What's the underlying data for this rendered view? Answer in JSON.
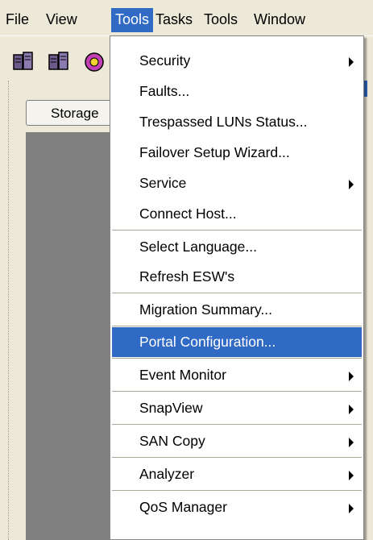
{
  "menubar": {
    "items": [
      {
        "label": "File"
      },
      {
        "label": "View"
      },
      {
        "label": "Tools"
      },
      {
        "label": "Tasks"
      },
      {
        "label": "Tools"
      },
      {
        "label": "Window"
      }
    ]
  },
  "toolbar": {
    "icons": [
      "storage-system-icon",
      "storage-system-icon",
      "wizard-icon"
    ]
  },
  "panel": {
    "tab_label": "Storage"
  },
  "tools_menu": {
    "items": [
      {
        "label": "Security",
        "submenu": true
      },
      {
        "label": "Faults..."
      },
      {
        "label": "Trespassed LUNs Status..."
      },
      {
        "label": "Failover Setup Wizard..."
      },
      {
        "label": "Service",
        "submenu": true
      },
      {
        "label": "Connect Host..."
      },
      {
        "label": "Select Language..."
      },
      {
        "label": "Refresh ESW's"
      },
      {
        "label": "Migration Summary..."
      },
      {
        "label": "Portal Configuration..."
      },
      {
        "label": "Event Monitor",
        "submenu": true
      },
      {
        "label": "SnapView",
        "submenu": true
      },
      {
        "label": "SAN Copy",
        "submenu": true
      },
      {
        "label": "Analyzer",
        "submenu": true
      },
      {
        "label": "QoS Manager",
        "submenu": true
      }
    ],
    "selected_item": "Portal Configuration..."
  },
  "colors": {
    "highlight": "#316ac5",
    "window_bg": "#ece9d8",
    "panel_bg": "#808080"
  }
}
